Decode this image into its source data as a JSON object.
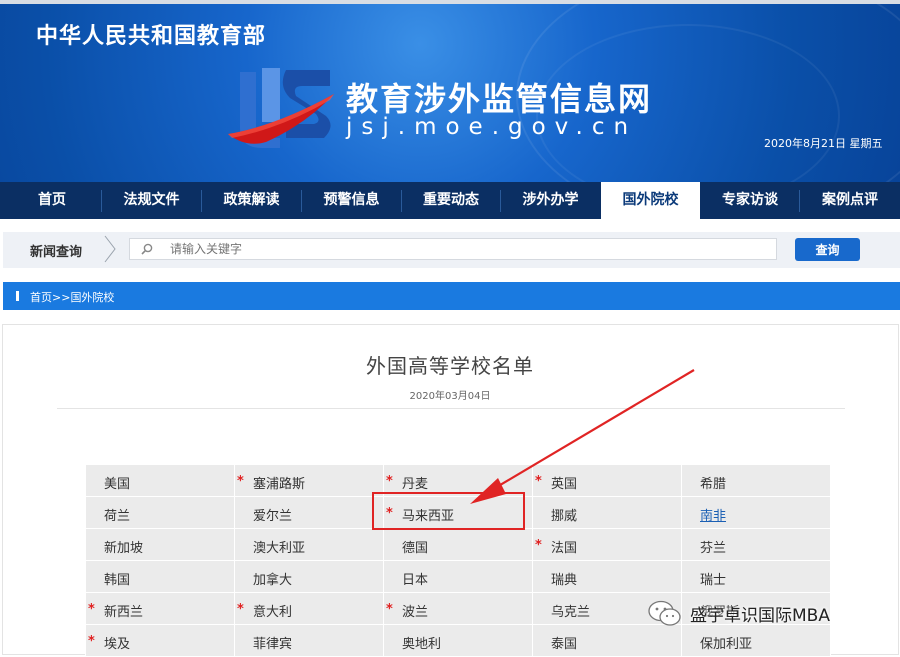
{
  "header": {
    "ministry": "中华人民共和国教育部",
    "site_title": "教育涉外监管信息网",
    "site_url": "jsj.moe.gov.cn",
    "date": "2020年8月21日 星期五"
  },
  "nav": {
    "items": [
      "首页",
      "法规文件",
      "政策解读",
      "预警信息",
      "重要动态",
      "涉外办学",
      "国外院校",
      "专家访谈",
      "案例点评"
    ],
    "active": "国外院校"
  },
  "search": {
    "label": "新闻查询",
    "placeholder": "请输入关键字",
    "button": "查询"
  },
  "breadcrumb": {
    "home": "首页",
    "sep": ">>",
    "current": "国外院校"
  },
  "document": {
    "title": "外国高等学校名单",
    "date": "2020年03月04日"
  },
  "countries": {
    "rows": [
      [
        {
          "name": "美国",
          "star": false
        },
        {
          "name": "塞浦路斯",
          "star": true
        },
        {
          "name": "丹麦",
          "star": true
        },
        {
          "name": "英国",
          "star": true
        },
        {
          "name": "希腊",
          "star": false
        }
      ],
      [
        {
          "name": "荷兰",
          "star": false
        },
        {
          "name": "爱尔兰",
          "star": false
        },
        {
          "name": "马来西亚",
          "star": true
        },
        {
          "name": "挪威",
          "star": false
        },
        {
          "name": "南非",
          "star": false,
          "link": true
        }
      ],
      [
        {
          "name": "新加坡",
          "star": false
        },
        {
          "name": "澳大利亚",
          "star": false
        },
        {
          "name": "德国",
          "star": false
        },
        {
          "name": "法国",
          "star": true
        },
        {
          "name": "芬兰",
          "star": false
        }
      ],
      [
        {
          "name": "韩国",
          "star": false
        },
        {
          "name": "加拿大",
          "star": false
        },
        {
          "name": "日本",
          "star": false
        },
        {
          "name": "瑞典",
          "star": false
        },
        {
          "name": "瑞士",
          "star": false
        }
      ],
      [
        {
          "name": "新西兰",
          "star": true
        },
        {
          "name": "意大利",
          "star": true
        },
        {
          "name": "波兰",
          "star": true
        },
        {
          "name": "乌克兰",
          "star": false
        },
        {
          "name": "俄罗斯",
          "star": false
        }
      ],
      [
        {
          "name": "埃及",
          "star": true
        },
        {
          "name": "菲律宾",
          "star": false
        },
        {
          "name": "奥地利",
          "star": false
        },
        {
          "name": "泰国",
          "star": false
        },
        {
          "name": "保加利亚",
          "star": false
        }
      ]
    ],
    "star_symbol": "*"
  },
  "watermark": {
    "text": "盛宇卓识国际MBA"
  },
  "colors": {
    "header_blue": "#1766cc",
    "nav_dark": "#0b2f63",
    "accent": "#1a7ae0",
    "annotation_red": "#e02424"
  }
}
